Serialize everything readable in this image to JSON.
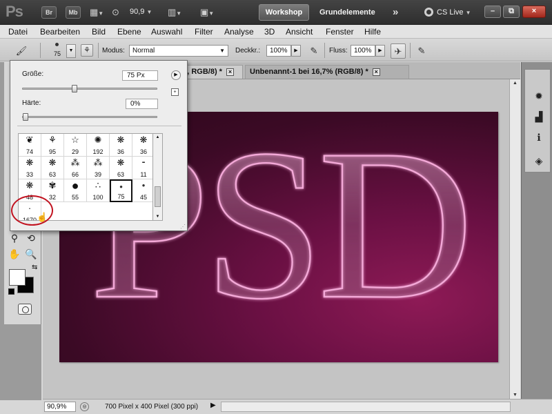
{
  "app": {
    "logo": "Ps",
    "bridge_label": "Br",
    "minibridge_label": "Mb",
    "zoom": "90,9",
    "workspace_button": "Workshop",
    "workspace_label": "Grundelemente",
    "more": "»",
    "cs_live": "CS Live",
    "window_controls": {
      "minimize": "–",
      "restore": "⧉",
      "close": "×"
    }
  },
  "menu": {
    "items": [
      "Datei",
      "Bearbeiten",
      "Bild",
      "Ebene",
      "Auswahl",
      "Filter",
      "Analyse",
      "3D",
      "Ansicht",
      "Fenster",
      "Hilfe"
    ]
  },
  "options": {
    "brush_size": "75",
    "mode_label": "Modus:",
    "mode_value": "Normal",
    "opacity_label": "Deckkr.:",
    "opacity_value": "100%",
    "flow_label": "Fluss:",
    "flow_value": "100%"
  },
  "documents": {
    "tab1": "ke, RGB/8) *",
    "tab2": "Unbenannt-1 bei 16,7% (RGB/8) *",
    "close_glyph": "×"
  },
  "artwork": {
    "text": "PSD"
  },
  "brush_picker": {
    "size_label": "Größe:",
    "size_value": "75 Px",
    "size_fraction": 0.38,
    "hardness_label": "Härte:",
    "hardness_value": "0%",
    "hardness_fraction": 0.0,
    "presets": [
      {
        "label": "74",
        "icon": "leaf-brush-icon"
      },
      {
        "label": "95",
        "icon": "grass-brush-icon"
      },
      {
        "label": "29",
        "icon": "star-brush-icon"
      },
      {
        "label": "192",
        "icon": "starburst-brush-icon"
      },
      {
        "label": "36",
        "icon": "texture-brush-icon"
      },
      {
        "label": "36",
        "icon": "texture-brush-icon"
      },
      {
        "label": "33",
        "icon": "texture-brush-icon"
      },
      {
        "label": "63",
        "icon": "texture-brush-icon"
      },
      {
        "label": "66",
        "icon": "spatter-brush-icon"
      },
      {
        "label": "39",
        "icon": "spatter-brush-icon"
      },
      {
        "label": "63",
        "icon": "texture-brush-icon"
      },
      {
        "label": "11",
        "icon": "dash-brush-icon"
      },
      {
        "label": "48",
        "icon": "texture-brush-icon"
      },
      {
        "label": "32",
        "icon": "maple-brush-icon"
      },
      {
        "label": "55",
        "icon": "hard-round-brush-icon"
      },
      {
        "label": "100",
        "icon": "spray-brush-icon"
      },
      {
        "label": "75",
        "icon": "soft-round-brush-icon"
      },
      {
        "label": "45",
        "icon": "soft-round-brush-icon"
      },
      {
        "label": "1670",
        "icon": "custom-brush-icon"
      }
    ],
    "selected_index": 16
  },
  "status": {
    "zoom": "90,9%",
    "info": "700 Pixel x 400 Pixel (300 ppi)"
  },
  "colors": {
    "accent_red": "#c1121f",
    "canvas_dark": "#2a0719",
    "canvas_magenta": "#8e1a56",
    "glow_pink": "#f4a9d8"
  }
}
